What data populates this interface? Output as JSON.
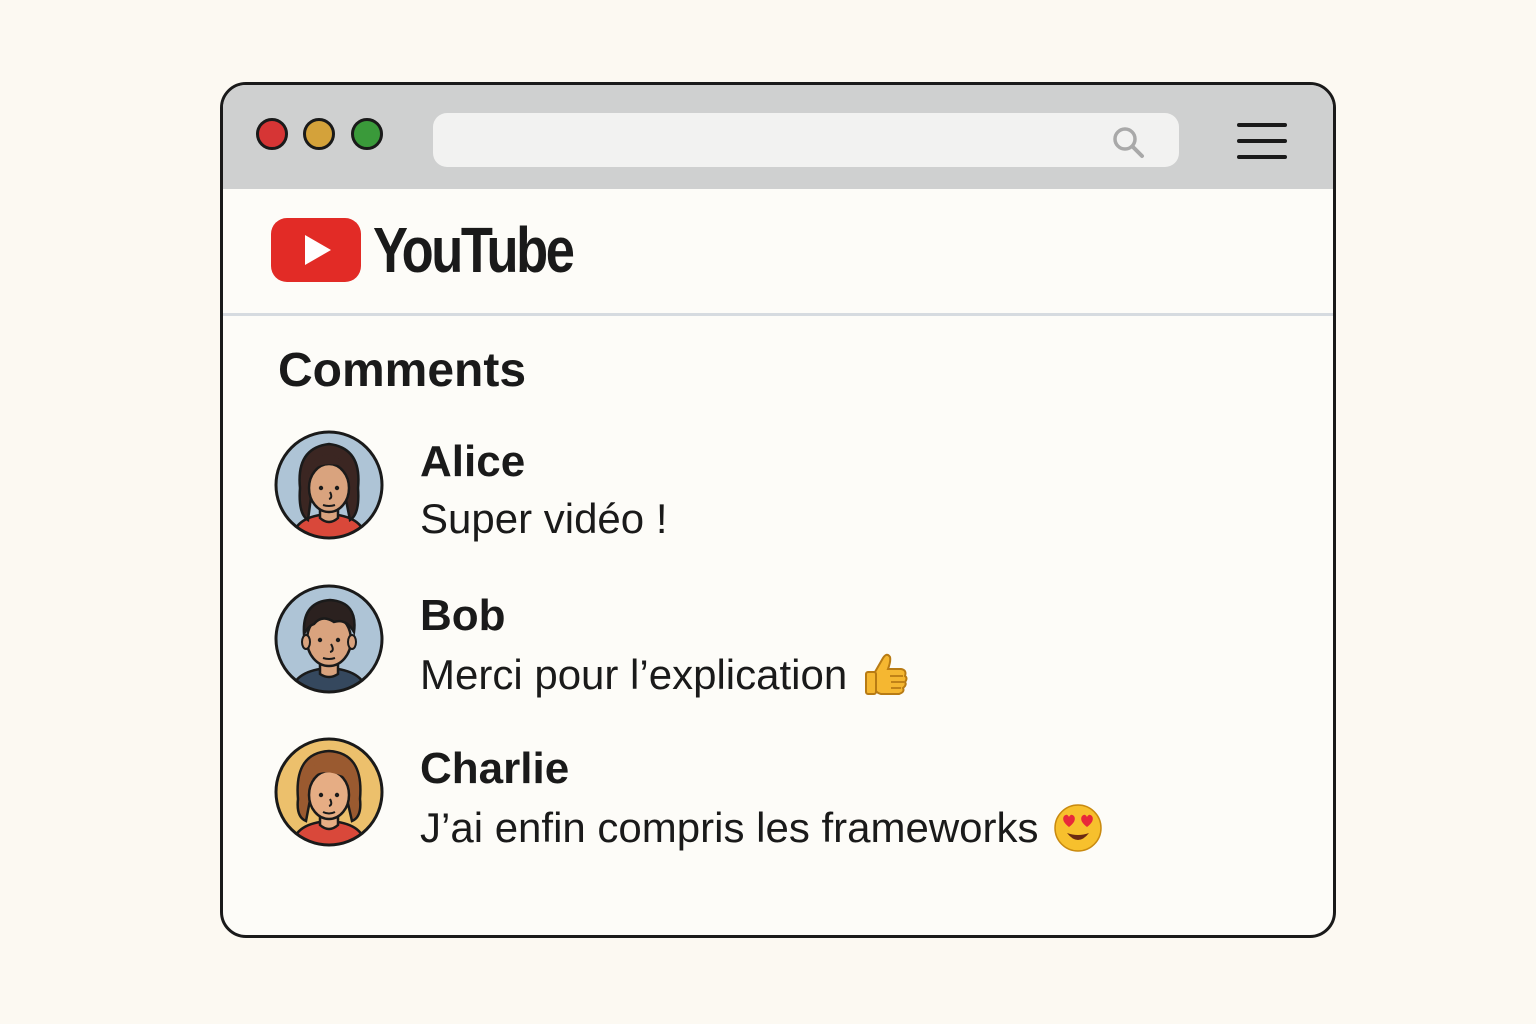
{
  "colors": {
    "page_background": "#fcf9f2",
    "window_background": "#fdfcf8",
    "titlebar": "#cfd0d0",
    "close_dot": "#d63535",
    "minimize_dot": "#d4a23a",
    "maximize_dot": "#3a9a3a",
    "youtube_red": "#e22b26",
    "text": "#1a1a1a"
  },
  "browser": {
    "address_bar": {
      "value": "",
      "placeholder": ""
    },
    "icons": {
      "search": "search-icon",
      "menu": "hamburger-menu-icon"
    }
  },
  "header": {
    "logo_text": "YouTube",
    "logo_icon": "youtube-play-icon"
  },
  "comments_section": {
    "title": "Comments",
    "items": [
      {
        "author": "Alice",
        "text": "Super vidéo !",
        "emoji": "",
        "avatar_bg": "#aec4d6",
        "avatar_shirt": "#d9483a"
      },
      {
        "author": "Bob",
        "text": "Merci pour l’explication",
        "emoji": "thumbs-up-icon",
        "avatar_bg": "#aec4d6",
        "avatar_shirt": "#35485e"
      },
      {
        "author": "Charlie",
        "text": "J’ai enfin compris les frameworks",
        "emoji": "heart-eyes-emoji-icon",
        "avatar_bg": "#ecc06c",
        "avatar_shirt": "#d9483a"
      }
    ]
  }
}
